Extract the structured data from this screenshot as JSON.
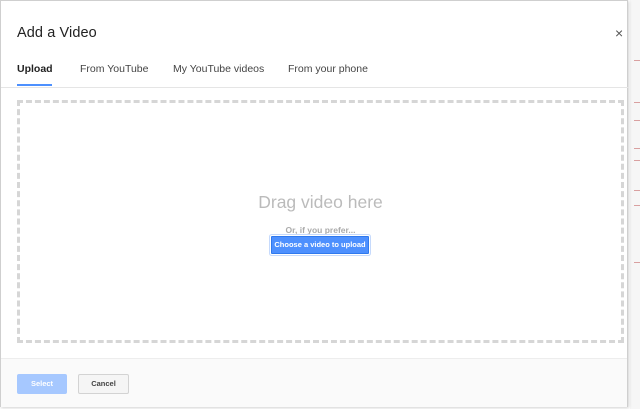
{
  "dialog": {
    "title": "Add a Video",
    "close_symbol": "×"
  },
  "tabs": [
    {
      "label": "Upload",
      "active": true
    },
    {
      "label": "From YouTube",
      "active": false
    },
    {
      "label": "My YouTube videos",
      "active": false
    },
    {
      "label": "From your phone",
      "active": false
    }
  ],
  "dropzone": {
    "drag_text": "Drag video here",
    "prefer_text": "Or, if you prefer...",
    "choose_button": "Choose a video to upload"
  },
  "footer": {
    "select_label": "Select",
    "cancel_label": "Cancel"
  },
  "colors": {
    "accent": "#4d90fe",
    "select_disabled": "#a6c8ff"
  }
}
